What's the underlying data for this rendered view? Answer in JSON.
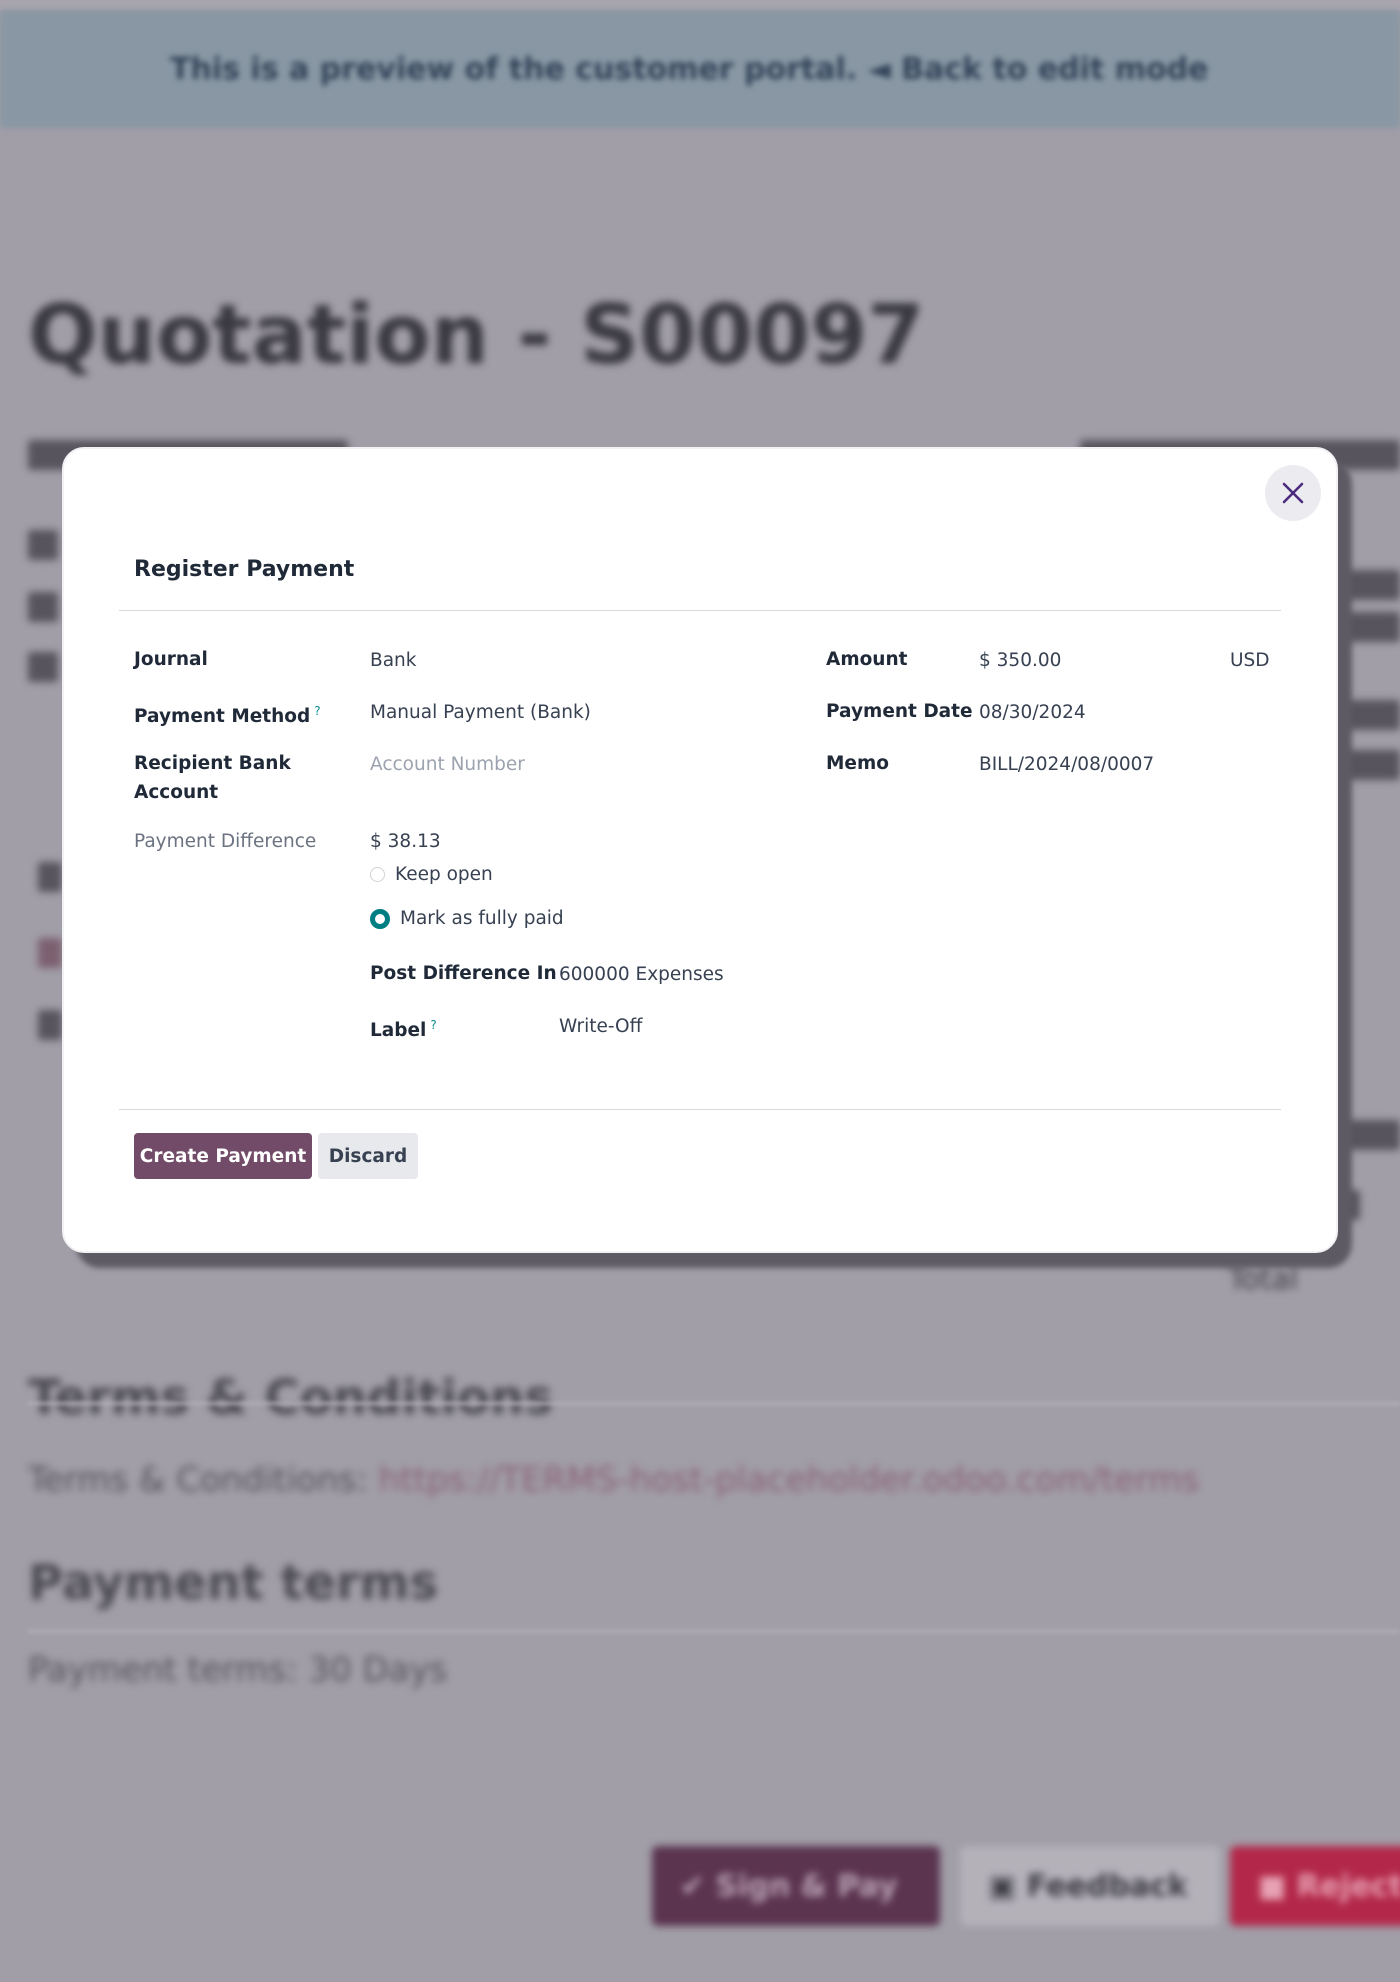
{
  "background": {
    "banner_text": "This is a preview of the customer portal. ◄ Back to edit mode",
    "title": "Quotation - S00097",
    "terms_heading": "Terms & Conditions",
    "terms_text_prefix": "Terms & Conditions: ",
    "terms_link": "https://TERMS-host-placeholder.odoo.com/terms",
    "payment_terms_heading": "Payment terms",
    "payment_terms_text": "Payment terms: 30 Days",
    "total_label": "Total",
    "buttons": {
      "sign": "✔ Sign & Pay",
      "feedback": "▣ Feedback",
      "reject": "■ Reject"
    }
  },
  "modal": {
    "title": "Register Payment",
    "close_icon": "close-icon",
    "help_mark": "?",
    "fields": {
      "journal": {
        "label": "Journal",
        "value": "Bank"
      },
      "payment_method": {
        "label": "Payment Method",
        "value": "Manual Payment (Bank)"
      },
      "recipient_bank": {
        "label_line1": "Recipient Bank",
        "label_line2": "Account",
        "placeholder": "Account Number"
      },
      "amount": {
        "label": "Amount",
        "value": "$ 350.00",
        "currency": "USD"
      },
      "payment_date": {
        "label": "Payment Date",
        "value": "08/30/2024"
      },
      "memo": {
        "label": "Memo",
        "value": "BILL/2024/08/0007"
      },
      "payment_difference": {
        "label": "Payment Difference",
        "value": "$ 38.13"
      },
      "difference_options": [
        {
          "label": "Keep open",
          "checked": false
        },
        {
          "label": "Mark as fully paid",
          "checked": true
        }
      ],
      "post_difference": {
        "label": "Post Difference In",
        "value": "600000 Expenses"
      },
      "writeoff_label": {
        "label": "Label",
        "value": "Write-Off"
      }
    },
    "buttons": {
      "create": "Create Payment",
      "discard": "Discard"
    }
  },
  "colors": {
    "primary": "#714b67",
    "radio_checked": "#017e84",
    "help": "#0e8a8f",
    "overlay": "#a19ea8"
  }
}
